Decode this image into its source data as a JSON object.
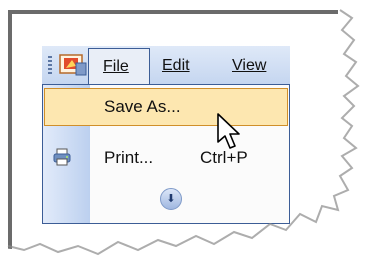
{
  "menubar": {
    "items": [
      {
        "label": "File"
      },
      {
        "label": "Edit"
      },
      {
        "label": "View"
      }
    ]
  },
  "dropdown": {
    "save_as": {
      "label": "Save As..."
    },
    "print": {
      "label": "Print...",
      "shortcut": "Ctrl+P"
    },
    "expand_icon": "double-chevron-down-icon"
  },
  "colors": {
    "menubar": "#c5d6f0",
    "highlight": "#fde7b0",
    "highlight_border": "#d08f2a",
    "frame_border": "#3c5d96"
  }
}
